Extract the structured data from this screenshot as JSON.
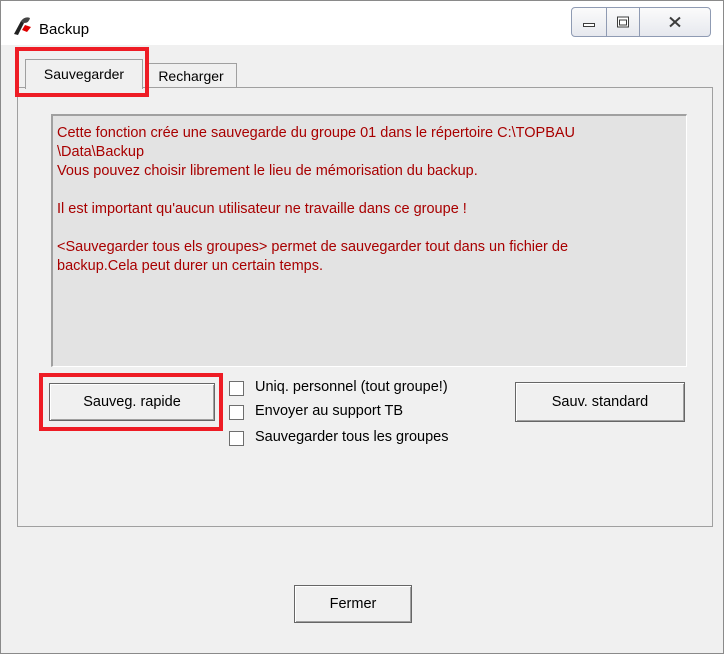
{
  "window": {
    "title": "Backup",
    "controls": [
      "minimize-icon",
      "maximize-icon",
      "close-icon"
    ]
  },
  "tabs": [
    {
      "label": "Sauvegarder",
      "active": true
    },
    {
      "label": "Recharger",
      "active": false
    }
  ],
  "info": {
    "line1": "Cette fonction crée une sauvegarde du groupe 01 dans le répertoire C:\\TOPBAU",
    "line2": "\\Data\\Backup",
    "line3": "Vous pouvez choisir librement le lieu de mémorisation du backup.",
    "line4": "Il est important qu'aucun utilisateur ne travaille dans ce groupe !",
    "line5": "<Sauvegarder tous els groupes> permet de sauvegarder tout dans un fichier de",
    "line6": "backup.Cela peut durer un certain temps."
  },
  "buttons": {
    "quick_save": "Sauveg. rapide",
    "standard_save": "Sauv. standard",
    "close": "Fermer"
  },
  "checkboxes": [
    {
      "label": "Uniq. personnel (tout groupe!)",
      "checked": false
    },
    {
      "label": "Envoyer au support TB",
      "checked": false
    },
    {
      "label": "Sauvegarder tous les groupes",
      "checked": false
    }
  ],
  "colors": {
    "info_text": "#a80000",
    "highlight": "#ee1c25",
    "window_bg": "#f0f0f0"
  }
}
